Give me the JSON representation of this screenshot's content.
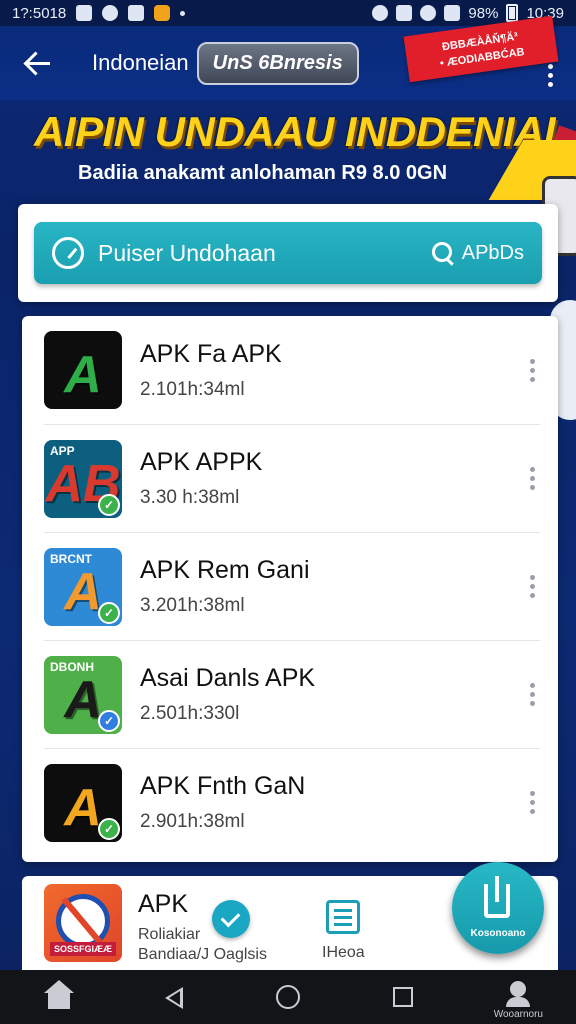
{
  "status_bar": {
    "left_text": "1?:5018",
    "battery": "98%",
    "time": "10:39"
  },
  "app_bar": {
    "title": "Indoneian",
    "pill_label": "UnS 6Bnresis",
    "ribbon_line1": "ĐBBÆÀÅŇ¶Ä³",
    "ribbon_line2": "• ÆODIABBĆAB"
  },
  "banner": {
    "headline": "AIPIN UNDAAU INDDENIAI",
    "subline": "Badiia anakamt anlohaman R9 8.0 0GN"
  },
  "search": {
    "placeholder": "Puiser Undohaan",
    "button_label": "APbDs"
  },
  "apps": [
    {
      "name": "APK Fa APK",
      "meta": "2.101h:34ml",
      "icon_mini": "",
      "icon_glyph": "A",
      "icon_bg": "#0d0d0d",
      "icon_fg": "#2fae48",
      "badge_color": ""
    },
    {
      "name": "APK  APPK",
      "meta": "3.30 h:38ml",
      "icon_mini": "APP",
      "icon_glyph": "AB",
      "icon_bg": "#0c5f7f",
      "icon_fg": "#d83a2f",
      "badge_color": "#3bb34a"
    },
    {
      "name": "APK Rem Gani",
      "meta": "3.201h:38ml",
      "icon_mini": "BRCNT",
      "icon_glyph": "A",
      "icon_bg": "#2f8ad6",
      "icon_fg": "#f29a2e",
      "badge_color": "#3bb34a"
    },
    {
      "name": "Asai Danls APK",
      "meta": "2.501h:330l",
      "icon_mini": "DBONH",
      "icon_glyph": "A",
      "icon_bg": "#4fb04a",
      "icon_fg": "#1a1a1a",
      "badge_color": "#2f7ee0"
    },
    {
      "name": "APK Fnth GaN",
      "meta": "2.901h:38ml",
      "icon_mini": "",
      "icon_glyph": "A",
      "icon_bg": "#0d0d0d",
      "icon_fg": "#f2a51f",
      "badge_color": "#3bb34a"
    }
  ],
  "bottom_card": {
    "title": "APK",
    "sub1": "Roliakiar",
    "sub2": "Bandiaa/J Oaglsis",
    "icon_label": "SOSSFGIÆÆ",
    "list_label": "IHeoa"
  },
  "fab": {
    "label": "Kosonoano"
  },
  "nav": {
    "profile_label": "Wooarnoru"
  },
  "colors": {
    "accent": "#1fa7b8",
    "banner_yellow": "#ffd21a",
    "header_blue": "#0b2f86"
  }
}
